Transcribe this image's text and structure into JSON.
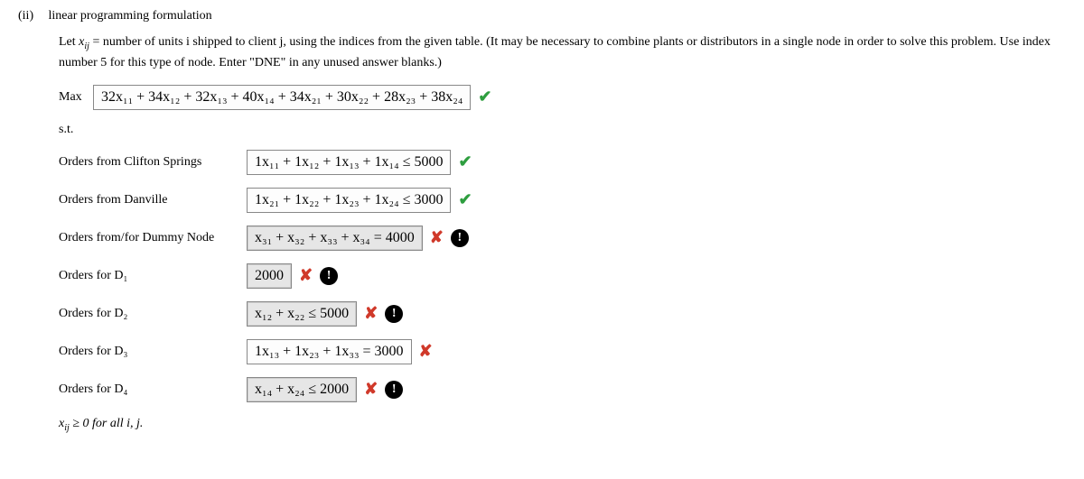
{
  "part": {
    "num": "(ii)",
    "title": "linear programming formulation"
  },
  "intro": {
    "line1_pre": "Let ",
    "line1_var": "x",
    "line1_sub": "ij",
    "line1_post": " = number of units i shipped to client j, using the indices from the given table. (It may be necessary to combine plants or distributors in a single node in order to solve this problem. Use index number 5 for this type of node. Enter \"DNE\" in any unused answer blanks.)"
  },
  "objective": {
    "label": "Max",
    "expr": "32x₁₁ + 34x₁₂ + 32x₁₃ + 40x₁₄ + 34x₂₁ + 30x₂₂ + 28x₂₃ + 38x₂₄"
  },
  "st_label": "s.t.",
  "constraints": [
    {
      "label": "Orders from Clifton Springs",
      "expr": "1x₁₁ + 1x₁₂ + 1x₁₃ + 1x₁₄ ≤ 5000",
      "shaded": false,
      "marks": [
        "check"
      ]
    },
    {
      "label": "Orders from Danville",
      "expr": "1x₂₁ + 1x₂₂ + 1x₂₃ + 1x₂₄ ≤ 3000",
      "shaded": false,
      "marks": [
        "check"
      ]
    },
    {
      "label": "Orders from/for Dummy Node",
      "expr": "x₃₁ + x₃₂ + x₃₃ + x₃₄ = 4000",
      "shaded": true,
      "marks": [
        "cross",
        "bang"
      ]
    },
    {
      "label": "Orders for D₁",
      "expr": "2000",
      "shaded": true,
      "marks": [
        "cross",
        "bang"
      ]
    },
    {
      "label": "Orders for D₂",
      "expr": "x₁₂ + x₂₂ ≤ 5000",
      "shaded": true,
      "marks": [
        "cross",
        "bang"
      ]
    },
    {
      "label": "Orders for D₃",
      "expr": "1x₁₃ + 1x₂₃ + 1x₃₃ = 3000",
      "shaded": false,
      "marks": [
        "cross"
      ]
    },
    {
      "label": "Orders for D₄",
      "expr": "x₁₄ + x₂₄ ≤ 2000",
      "shaded": true,
      "marks": [
        "cross",
        "bang"
      ]
    }
  ],
  "nonneg": {
    "var": "x",
    "sub": "ij",
    "text": " ≥ 0 for all i, j."
  }
}
